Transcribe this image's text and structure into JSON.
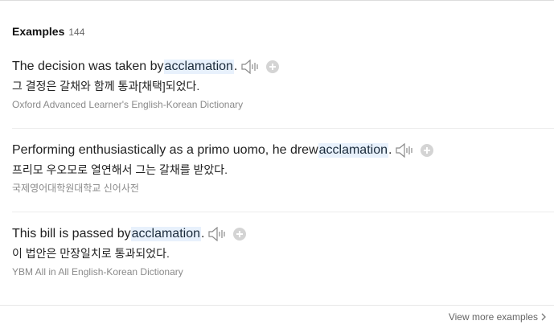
{
  "header": {
    "title": "Examples",
    "count": "144"
  },
  "examples": [
    {
      "before": "The decision was taken by ",
      "highlight": "acclamation",
      "after": ".",
      "translation": "그 결정은 갈채와 함께 통과[채택]되었다.",
      "source": "Oxford Advanced Learner's English-Korean Dictionary"
    },
    {
      "before": "Performing enthusiastically as a primo uomo, he drew ",
      "highlight": "acclamation",
      "after": ".",
      "translation": "프리모 우오모로 열연해서 그는 갈채를 받았다.",
      "source": "국제영어대학원대학교 신어사전"
    },
    {
      "before": "This bill is passed by ",
      "highlight": "acclamation",
      "after": ".",
      "translation": "이 법안은 만장일치로 통과되었다.",
      "source": "YBM All in All English-Korean Dictionary"
    }
  ],
  "footer": {
    "view_more": "View more examples"
  },
  "icons": {
    "audio": "speaker-icon",
    "add": "plus-circle-icon",
    "more": "chevron-right-icon"
  },
  "colors": {
    "highlight_bg": "#e8f1fc",
    "muted": "#8a8a8a",
    "icon_gray": "#d4d4d4"
  }
}
